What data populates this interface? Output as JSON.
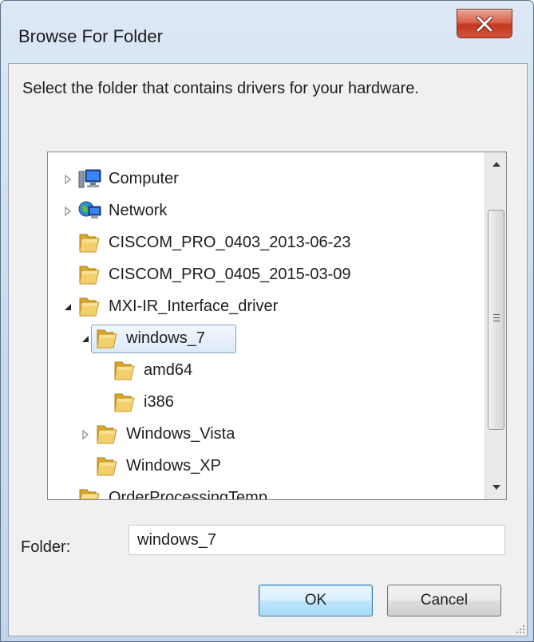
{
  "window": {
    "title": "Browse For Folder",
    "close_icon": "close-icon"
  },
  "description": "Select the folder that contains drivers for your hardware.",
  "tree": {
    "items": [
      {
        "label": "Computer",
        "icon": "computer-icon",
        "expander": "collapsed"
      },
      {
        "label": "Network",
        "icon": "network-icon",
        "expander": "collapsed"
      },
      {
        "label": "CISCOM_PRO_0403_2013-06-23",
        "icon": "folder-icon",
        "expander": "none"
      },
      {
        "label": "CISCOM_PRO_0405_2015-03-09",
        "icon": "folder-icon",
        "expander": "none"
      },
      {
        "label": "MXI-IR_Interface_driver",
        "icon": "folder-icon",
        "expander": "expanded"
      },
      {
        "label": "windows_7",
        "icon": "folder-icon",
        "expander": "expanded",
        "selected": true
      },
      {
        "label": "amd64",
        "icon": "folder-icon",
        "expander": "none"
      },
      {
        "label": "i386",
        "icon": "folder-icon",
        "expander": "none"
      },
      {
        "label": "Windows_Vista",
        "icon": "folder-icon",
        "expander": "collapsed"
      },
      {
        "label": "Windows_XP",
        "icon": "folder-icon",
        "expander": "none"
      },
      {
        "label": "OrderProcessingTemp",
        "icon": "folder-icon",
        "expander": "none"
      }
    ]
  },
  "folder": {
    "label": "Folder:",
    "value": "windows_7"
  },
  "buttons": {
    "ok": "OK",
    "cancel": "Cancel"
  },
  "colors": {
    "selection_border": "#7da2ce",
    "folder_yellow": "#e8c14a",
    "close_red": "#c4361f"
  }
}
